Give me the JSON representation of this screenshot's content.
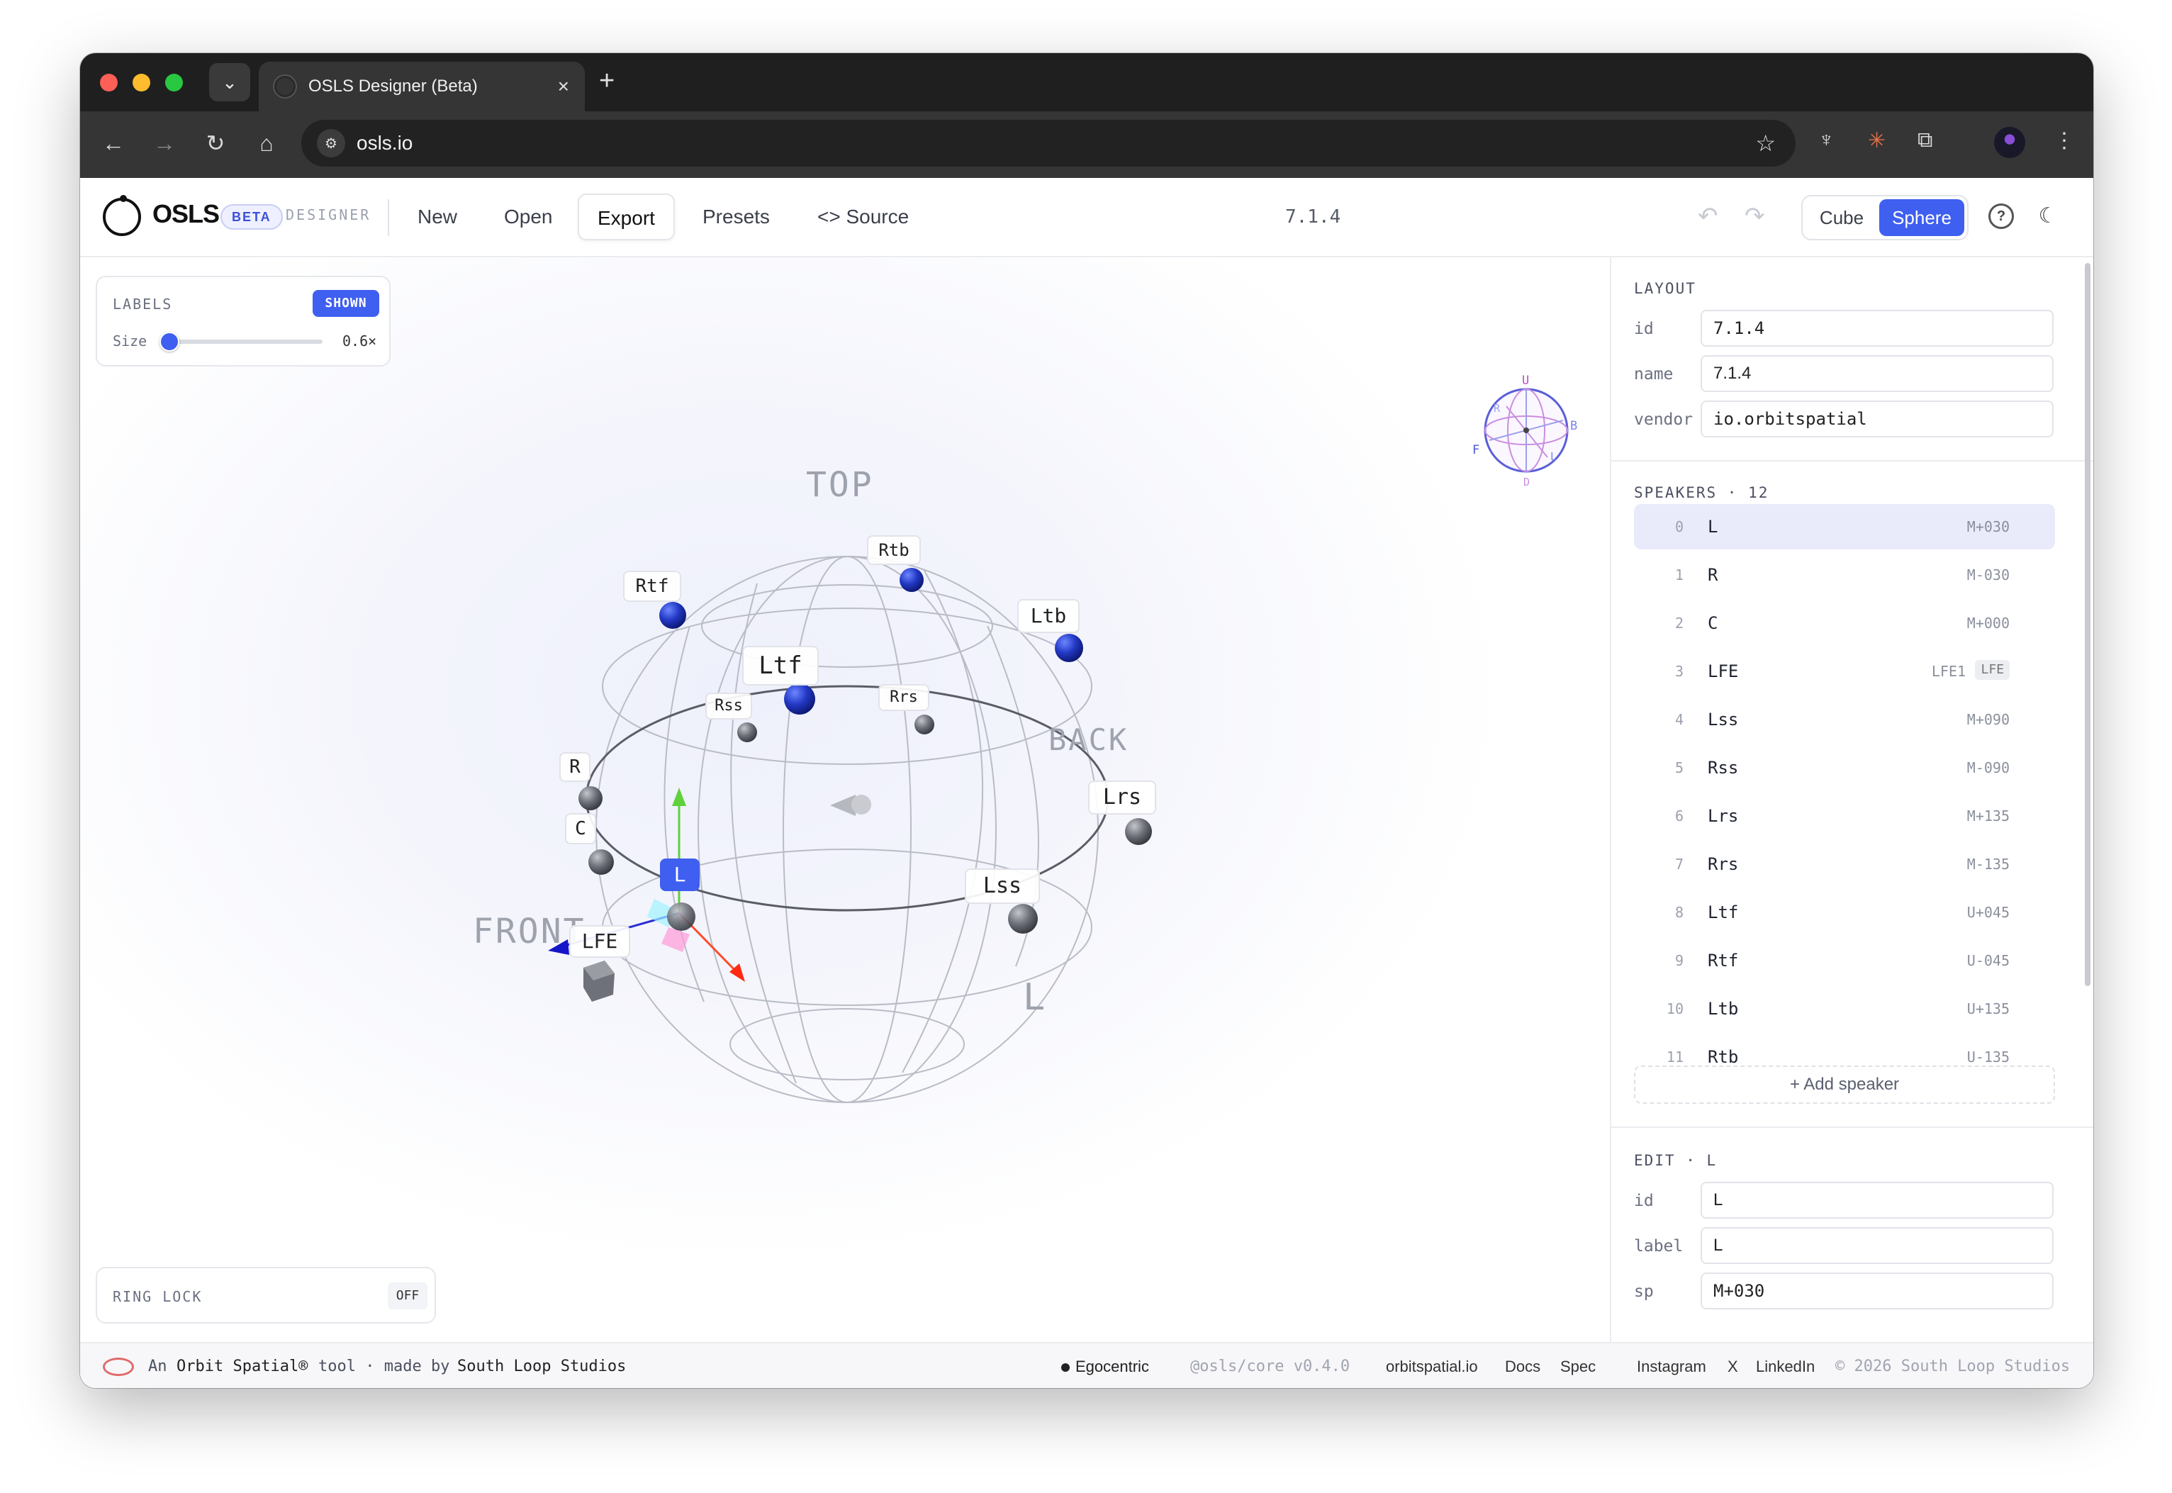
{
  "browser": {
    "tab_title": "OSLS Designer (Beta)",
    "url": "osls.io"
  },
  "app": {
    "brand": "OSLS",
    "beta": "BETA",
    "designer": "DESIGNER",
    "menu": [
      "New",
      "Open",
      "Export",
      "Presets",
      "Source"
    ],
    "active_menu": "Export",
    "layout_title": "7.1.4",
    "view_modes": [
      "Cube",
      "Sphere"
    ],
    "active_view": "Sphere",
    "accent": "#3f5ff0"
  },
  "labels_panel": {
    "caption": "LABELS",
    "state": "SHOWN",
    "size_label": "Size",
    "size_value": "0.6×",
    "size_fraction": 0.0
  },
  "ring_lock": {
    "caption": "RING LOCK",
    "state": "OFF"
  },
  "scene": {
    "axis_words": [
      "TOP",
      "BACK",
      "FRONT",
      "L"
    ],
    "gizmo_letters": [
      "U",
      "B",
      "F",
      "R",
      "L",
      "D"
    ],
    "labels": [
      "Rtb",
      "Rtf",
      "Ltb",
      "Ltf",
      "Rss",
      "Rrs",
      "R",
      "C",
      "L",
      "Lss",
      "Lrs",
      "LFE"
    ]
  },
  "sidebar": {
    "layout_caption": "LAYOUT",
    "fields": [
      {
        "label": "id",
        "value": "7.1.4"
      },
      {
        "label": "name",
        "value": "7.1.4"
      },
      {
        "label": "vendor",
        "value": "io.orbitspatial"
      }
    ],
    "speakers_caption": "SPEAKERS · 12",
    "speakers": [
      {
        "index": "0",
        "name": "L",
        "sp": "M+030"
      },
      {
        "index": "1",
        "name": "R",
        "sp": "M-030"
      },
      {
        "index": "2",
        "name": "C",
        "sp": "M+000"
      },
      {
        "index": "3",
        "name": "LFE",
        "sp": "LFE1",
        "tag": "LFE"
      },
      {
        "index": "4",
        "name": "Lss",
        "sp": "M+090"
      },
      {
        "index": "5",
        "name": "Rss",
        "sp": "M-090"
      },
      {
        "index": "6",
        "name": "Lrs",
        "sp": "M+135"
      },
      {
        "index": "7",
        "name": "Rrs",
        "sp": "M-135"
      },
      {
        "index": "8",
        "name": "Ltf",
        "sp": "U+045"
      },
      {
        "index": "9",
        "name": "Rtf",
        "sp": "U-045"
      },
      {
        "index": "10",
        "name": "Ltb",
        "sp": "U+135"
      },
      {
        "index": "11",
        "name": "Rtb",
        "sp": "U-135"
      }
    ],
    "selected_index": 0,
    "add_speaker": "+ Add speaker",
    "edit_caption": "EDIT · L",
    "edit_fields": [
      {
        "label": "id",
        "value": "L"
      },
      {
        "label": "label",
        "value": "L"
      },
      {
        "label": "sp",
        "value": "M+030"
      }
    ]
  },
  "footer": {
    "tagline_1": "An",
    "tagline_2": "Orbit Spatial®",
    "tagline_3": "tool · made by",
    "tagline_4": "South Loop Studios",
    "mode": "Egocentric",
    "core": "@osls/core v0.4.0",
    "links": [
      "orbitspatial.io",
      "Docs",
      "Spec",
      "Instagram",
      "X",
      "LinkedIn"
    ],
    "copyright": "© 2026 South Loop Studios"
  }
}
